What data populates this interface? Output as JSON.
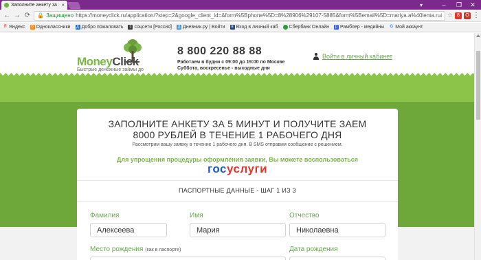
{
  "browser": {
    "tab_title": "Заполните анкету за 10",
    "close_glyph": "×",
    "nav": {
      "back": "←",
      "forward": "→",
      "reload": "⟳"
    },
    "secure_label": "Защищено",
    "url": "https://moneyclick.ru/application/?step=2&google_client_id=&form%5Bphone%5D=8%28906%29107-5885&form%5Bemail%5D=mariya.a%40lenta.ru&form%",
    "window_controls": {
      "minimize": "–",
      "maximize": "❐",
      "close": "✕"
    },
    "bookmarks": [
      {
        "label": "Яндекс",
        "color": "#e4332a",
        "glyph": "Я"
      },
      {
        "label": "Одноклассники",
        "color": "#f38b1a",
        "glyph": "о"
      },
      {
        "label": "Добро пожаловать",
        "color": "#2a6bc4",
        "glyph": "д"
      },
      {
        "label": "соцсети [Россия]",
        "color": "#3b3b3b",
        "glyph": "с"
      },
      {
        "label": "Дневник.ру | Войти",
        "color": "#4a90d9",
        "glyph": "д"
      },
      {
        "label": "Вход в личный каб",
        "color": "#244a86",
        "glyph": "в"
      },
      {
        "label": "Сбербанк Онлайн",
        "color": "#21a038",
        "glyph": "●"
      },
      {
        "label": "Рамблер - медийны",
        "color": "#315efb",
        "glyph": "р"
      },
      {
        "label": "Мой аккаунт",
        "color": "#ffffff",
        "glyph": "G"
      }
    ]
  },
  "header": {
    "brand_money": "Money",
    "brand_click": "Click",
    "tagline": "Быстрые денежные займы до зарплаты по всей России",
    "phone": "8 800 220 88 88",
    "hours_line1": "Работаем в будни с 09:00 до 19:00 по Москве",
    "hours_line2": "Суббота, воскресенье - выходные дни",
    "login_link": "Войти в личный кабинет"
  },
  "card": {
    "title_line1": "ЗАПОЛНИТЕ АНКЕТУ ЗА 5 МИНУТ И ПОЛУЧИТЕ ЗАЕМ",
    "title_line2": "8000 РУБЛЕЙ В ТЕЧЕНИЕ 1 РАБОЧЕГО ДНЯ",
    "subtitle": "Рассмотрим вашу заявку в течение 1 рабочего дня. В SMS отправим сообщение с решением.",
    "gos_prompt": "Для упрощения процедуры оформления заявки, Вы можете воспользоваться",
    "gos_logo_a": "гос",
    "gos_logo_b": "услуги",
    "step_title": "ПАСПОРТНЫЕ ДАННЫЕ - ШАГ 1 ИЗ 3"
  },
  "form": {
    "surname_label": "Фамилия",
    "surname_value": "Алексеева",
    "name_label": "Имя",
    "name_value": "Мария",
    "patronymic_label": "Отчество",
    "patronymic_value": "Николаевна",
    "birthplace_label": "Место рождения",
    "birthplace_hint": "(как в паспорте)",
    "birthdate_label": "Дата рождения"
  }
}
